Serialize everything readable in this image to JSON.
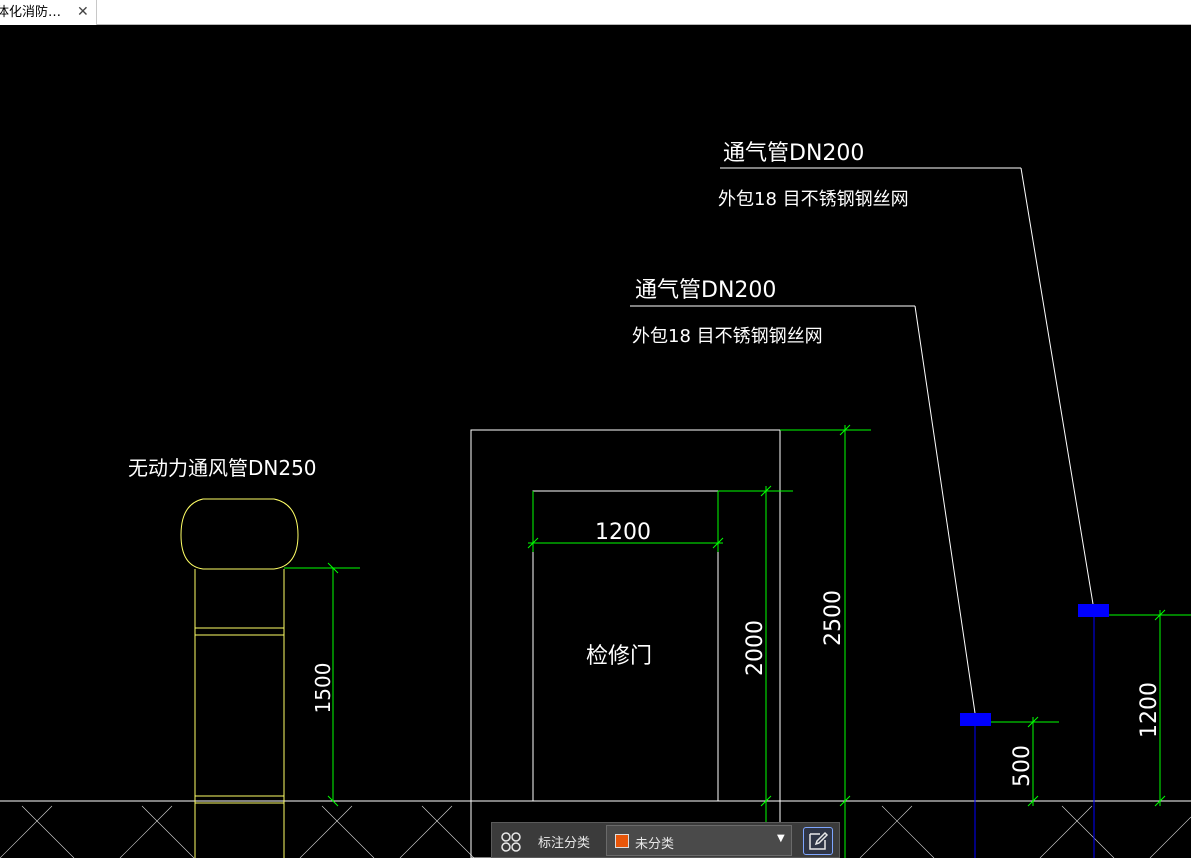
{
  "tab": {
    "title": "体化消防…",
    "close_glyph": "✕"
  },
  "drawing": {
    "vent_pipe_label": "无动力通风管DN250",
    "vent_pipe_height": "1500",
    "door_width": "1200",
    "door_label": "检修门",
    "door_height": "2000",
    "frame_height": "2500",
    "pipe_upper": {
      "label": "通气管DN200",
      "note": "外包18 目不锈钢钢丝网",
      "height": "1200"
    },
    "pipe_lower": {
      "label": "通气管DN200",
      "note": "外包18 目不锈钢钢丝网",
      "height": "500"
    }
  },
  "toolbar": {
    "layout_icon": "grid-icon",
    "label": "标注分类",
    "select_value": "未分类",
    "select_color": "#e8560a",
    "edit_icon": "edit-icon"
  },
  "colors": {
    "background": "#000000",
    "lines": "#ffffff",
    "dimensions": "#00ff00",
    "vent": "#ffff66",
    "marker": "#0000ff"
  }
}
